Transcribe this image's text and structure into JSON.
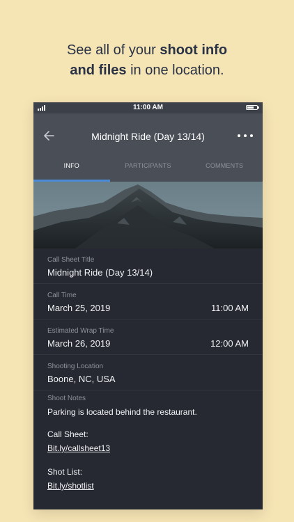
{
  "promo": {
    "line1_prefix": "See all of your ",
    "line1_bold": "shoot info",
    "line2_bold": "and files",
    "line2_suffix": " in one location."
  },
  "status_bar": {
    "time": "11:00 AM"
  },
  "nav": {
    "title": "Midnight Ride (Day 13/14)"
  },
  "tabs": [
    {
      "label": "INFO",
      "active": true
    },
    {
      "label": "PARTICIPANTS",
      "active": false
    },
    {
      "label": "COMMENTS",
      "active": false
    }
  ],
  "fields": {
    "call_sheet_title": {
      "label": "Call Sheet Title",
      "value": "Midnight Ride (Day 13/14)"
    },
    "call_time": {
      "label": "Call Time",
      "date": "March 25, 2019",
      "time": "11:00 AM"
    },
    "wrap_time": {
      "label": "Estimated Wrap Time",
      "date": "March 26, 2019",
      "time": "12:00 AM"
    },
    "location": {
      "label": "Shooting Location",
      "value": "Boone, NC, USA"
    },
    "notes": {
      "label": "Shoot Notes",
      "text": "Parking is located behind the restaurant.",
      "call_sheet_label": "Call Sheet:",
      "call_sheet_link": "Bit.ly/callsheet13",
      "shot_list_label": "Shot List:",
      "shot_list_link": "Bit.ly/shotlist"
    }
  },
  "colors": {
    "background": "#f5e4b4",
    "promo_text": "#2a3246",
    "navbar": "#4a4e57",
    "content": "#262932",
    "tab_indicator": "#4b8bd6"
  },
  "icons": [
    "signal-icon",
    "battery-icon",
    "back-arrow-icon",
    "more-options-icon"
  ]
}
